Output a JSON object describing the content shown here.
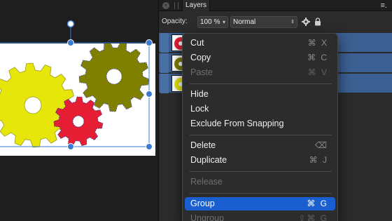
{
  "panel": {
    "tab_title": "Layers",
    "menu_icon": "≡.",
    "opacity_label": "Opacity:",
    "opacity_value": "100 %",
    "blend_mode": "Normal"
  },
  "layers": [
    {
      "color": "#e61e34"
    },
    {
      "color": "#808000"
    },
    {
      "color": "#e6e60a"
    }
  ],
  "context_menu": {
    "items": [
      {
        "label": "Cut",
        "shortcut": "⌘ X",
        "enabled": true
      },
      {
        "label": "Copy",
        "shortcut": "⌘ C",
        "enabled": true
      },
      {
        "label": "Paste",
        "shortcut": "⌘ V",
        "enabled": false
      },
      {
        "label": "Hide",
        "shortcut": "",
        "enabled": true
      },
      {
        "label": "Lock",
        "shortcut": "",
        "enabled": true
      },
      {
        "label": "Exclude From Snapping",
        "shortcut": "",
        "enabled": true
      },
      {
        "label": "Delete",
        "shortcut": "⌫",
        "enabled": true
      },
      {
        "label": "Duplicate",
        "shortcut": "⌘ J",
        "enabled": true
      },
      {
        "label": "Release",
        "shortcut": "",
        "enabled": false
      },
      {
        "label": "Group",
        "shortcut": "⌘ G",
        "enabled": true,
        "highlighted": true
      },
      {
        "label": "Ungroup",
        "shortcut": "⇧⌘ G",
        "enabled": false
      }
    ]
  },
  "colors": {
    "yellow_gear": "#e6e60a",
    "olive_gear": "#808000",
    "red_gear": "#e61e34",
    "selection": "#3a7bd5",
    "menu_highlight": "#1a5fd0"
  }
}
